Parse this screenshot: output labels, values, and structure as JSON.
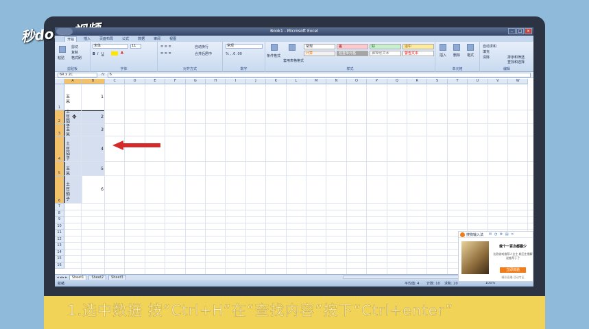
{
  "watermark": {
    "logo_text": "秒dong视频"
  },
  "window": {
    "title": "Book1 - Microsoft Excel",
    "buttons": [
      "–",
      "□",
      "×"
    ]
  },
  "ribbon_tabs": [
    "开始",
    "插入",
    "页面布局",
    "公式",
    "数据",
    "审阅",
    "视图"
  ],
  "ribbon": {
    "groups": [
      "剪贴板",
      "字体",
      "对齐方式",
      "数字",
      "样式",
      "单元格",
      "编辑"
    ],
    "clipboard": {
      "paste": "粘贴",
      "cut": "剪切",
      "copy": "复制",
      "format_painter": "格式刷"
    },
    "font": {
      "name": "宋体",
      "size": "11"
    },
    "alignment": {
      "wrap": "自动换行",
      "merge": "合并后居中"
    },
    "number": {
      "format": "常规"
    },
    "styles": {
      "conditional": "条件格式",
      "table_format": "套用表格格式",
      "cells": [
        {
          "label": "常规",
          "bg": "#ffffff"
        },
        {
          "label": "差",
          "bg": "#ffc7ce"
        },
        {
          "label": "好",
          "bg": "#c6efce"
        },
        {
          "label": "适中",
          "bg": "#ffeb9c"
        },
        {
          "label": "计算",
          "bg": "#f2f2f2"
        },
        {
          "label": "检查单元格",
          "bg": "#a5a5a5"
        },
        {
          "label": "解释性文本",
          "bg": "#ffffff"
        },
        {
          "label": "警告文本",
          "bg": "#ffffff"
        }
      ]
    },
    "cells_group": {
      "insert": "插入",
      "delete": "删除",
      "format": "格式"
    },
    "editing": {
      "autosum": "自动求和",
      "fill": "填充",
      "clear": "清除",
      "sort": "排序和筛选",
      "find": "查找和选择"
    }
  },
  "formula_bar": {
    "namebox": "6R x 2C",
    "fx": "fx",
    "value": "6"
  },
  "columns": [
    "A",
    "B",
    "C",
    "D",
    "E",
    "F",
    "G",
    "H",
    "I",
    "J",
    "K",
    "L",
    "M",
    "N",
    "O",
    "P",
    "Q",
    "R",
    "S",
    "T",
    "U",
    "V",
    "W"
  ],
  "rows": [
    {
      "num": "1",
      "a": [
        "玉",
        "米"
      ],
      "b": "1"
    },
    {
      "num": "2",
      "a": [
        "土",
        "豆",
        "茄",
        "子"
      ],
      "b": "2"
    },
    {
      "num": "3",
      "a": [
        "玉",
        "米"
      ],
      "b": "3"
    },
    {
      "num": "4",
      "a": [
        "土",
        "豆",
        "茄",
        "子"
      ],
      "b": "4"
    },
    {
      "num": "5",
      "a": [
        "玉",
        "米"
      ],
      "b": "5"
    },
    {
      "num": "6",
      "a": [
        "土",
        "豆",
        "茄",
        "子"
      ],
      "b": "6"
    }
  ],
  "empty_rows": [
    "7",
    "8",
    "9",
    "10",
    "11",
    "12",
    "13",
    "14",
    "15",
    "16"
  ],
  "sheet_tabs": {
    "nav": "◂ ◂ ▸ ▸",
    "tabs": [
      "Sheet1",
      "Sheet2",
      "Sheet3"
    ],
    "active": "Sheet1"
  },
  "status": {
    "ready": "就绪",
    "average": "平均值: 4",
    "count": "计数: 10",
    "sum": "求和: 20",
    "zoom": "100%"
  },
  "popup": {
    "app": "搜狗输入法",
    "title": "我个一百次都暴少",
    "text": "比欧游戏推荐人全主 耗回主播解说推荐于了",
    "button": "立即体验",
    "footer": "精彩直播·活动专区"
  },
  "caption": "1.选中数据 按“Ctrl+H”在“查找内容”按下“Ctrl+enter”"
}
